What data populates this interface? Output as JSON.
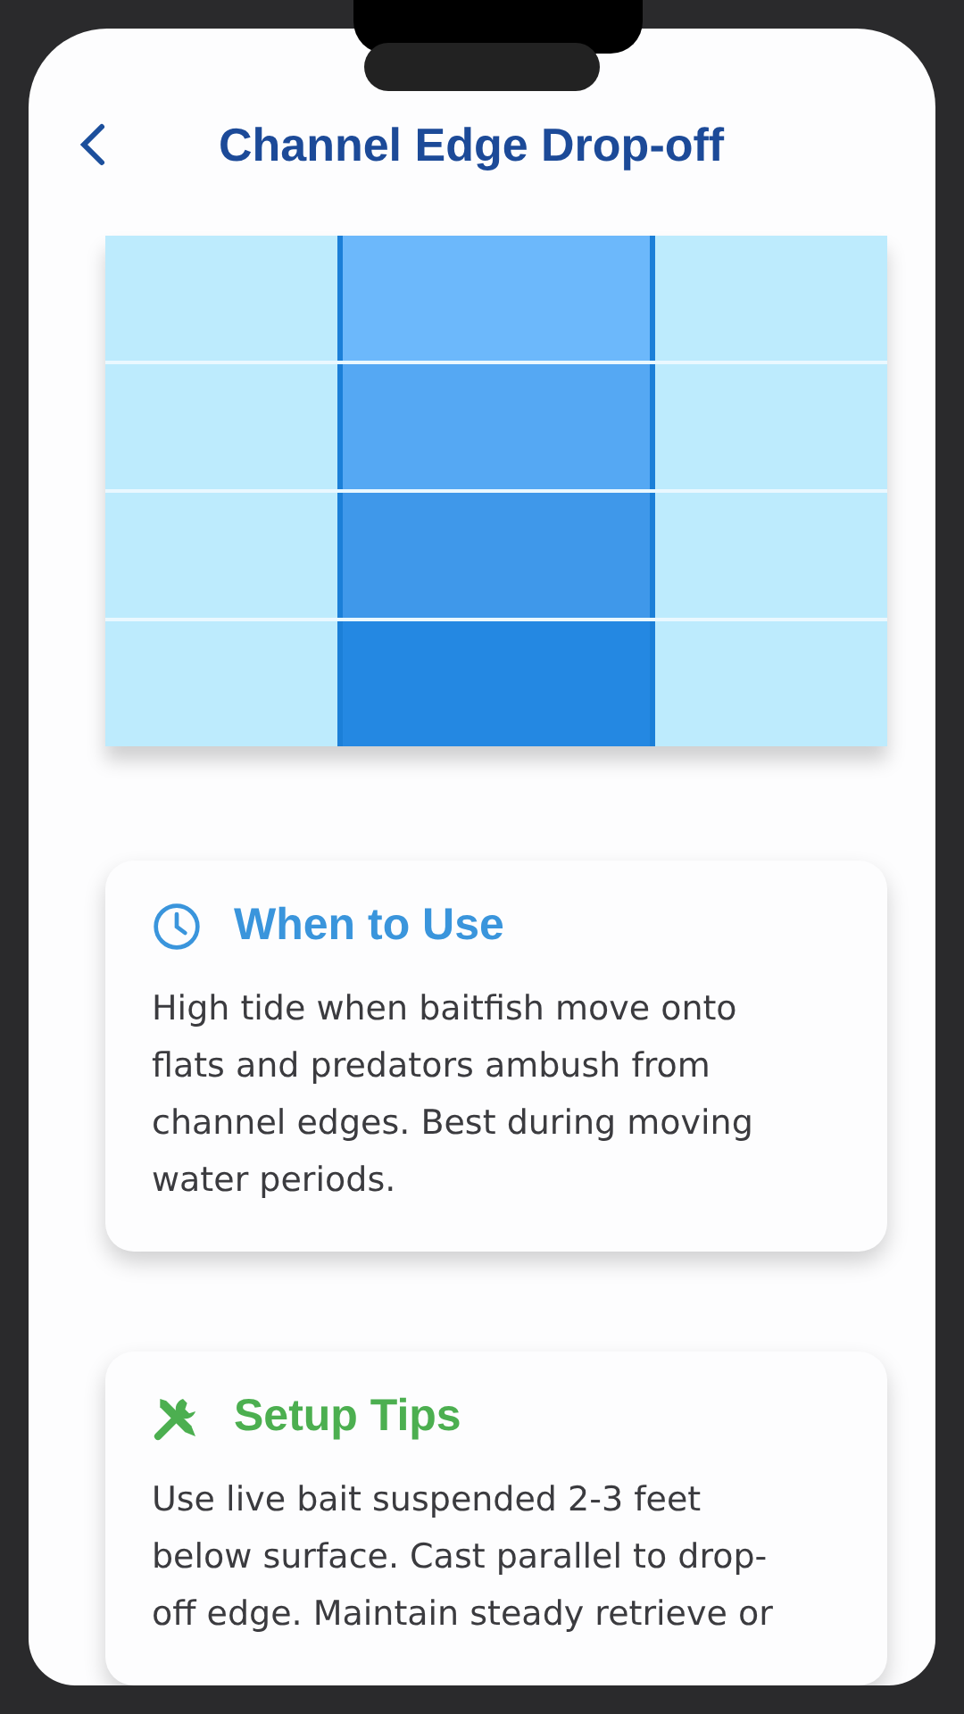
{
  "header": {
    "title": "Channel Edge Drop-off"
  },
  "sections": [
    {
      "kind": "timing",
      "title": "When to Use",
      "body": "High tide when baitfish move onto flats and predators ambush from channel edges. Best during moving water periods."
    },
    {
      "kind": "tools",
      "title": "Setup Tips",
      "body": "Use live bait suspended 2-3 feet below surface. Cast parallel to drop-off edge. Maintain steady retrieve or"
    }
  ]
}
